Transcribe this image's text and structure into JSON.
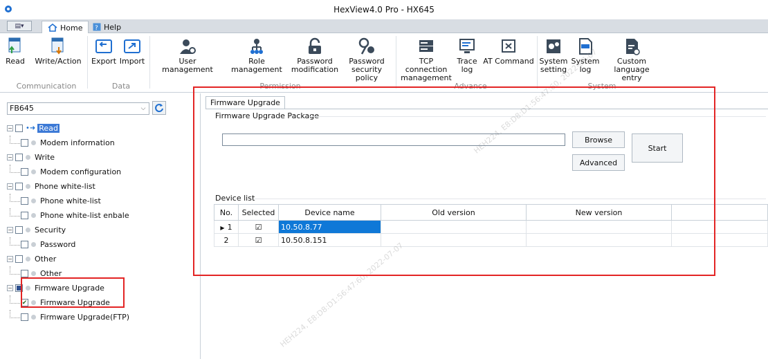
{
  "window": {
    "title": "HexView4.0 Pro - HX645"
  },
  "tabs": [
    {
      "label": "Home",
      "active": true
    },
    {
      "label": "Help",
      "active": false
    }
  ],
  "ribbon": {
    "communication": {
      "label": "Communication",
      "read": "Read",
      "write": "Write/Action"
    },
    "data": {
      "label": "Data",
      "export": "Export",
      "import": "Import"
    },
    "permission": {
      "label": "Permission",
      "user_mgmt": "User management",
      "role_mgmt": "Role management",
      "pwd_mod_1": "Password",
      "pwd_mod_2": "modification",
      "pwd_sec_1": "Password",
      "pwd_sec_2": "security policy"
    },
    "advance": {
      "label": "Advance",
      "tcp_1": "TCP connection",
      "tcp_2": "management",
      "trace_1": "Trace",
      "trace_2": "log",
      "at": "AT Command"
    },
    "system": {
      "label": "System",
      "setting_1": "System",
      "setting_2": "setting",
      "log_1": "System",
      "log_2": "log",
      "lang_1": "Custom",
      "lang_2": "language entry"
    }
  },
  "left": {
    "device_combo": "FB645",
    "tree": [
      {
        "label": "Read",
        "selected": true
      },
      {
        "label": "Modem information"
      },
      {
        "label": "Write"
      },
      {
        "label": "Modem configuration"
      },
      {
        "label": "Phone white-list"
      },
      {
        "label": "Phone white-list"
      },
      {
        "label": "Phone white-list enbale"
      },
      {
        "label": "Security"
      },
      {
        "label": "Password"
      },
      {
        "label": "Other"
      },
      {
        "label": "Other"
      },
      {
        "label": "Firmware Upgrade"
      },
      {
        "label": "Firmware Upgrade",
        "checked": true
      },
      {
        "label": "Firmware Upgrade(FTP)"
      }
    ]
  },
  "panel": {
    "tab": "Firmware Upgrade",
    "package_title": "Firmware Upgrade Package",
    "package_value": "",
    "browse": "Browse",
    "advanced": "Advanced",
    "start": "Start",
    "device_list_title": "Device list",
    "columns": [
      "No.",
      "Selected",
      "Device name",
      "Old version",
      "New version"
    ],
    "rows": [
      {
        "no": "1",
        "selected": "☑",
        "device": "10.50.8.77",
        "old": "",
        "new": ""
      },
      {
        "no": "2",
        "selected": "☑",
        "device": "10.50.8.151",
        "old": "",
        "new": ""
      }
    ]
  },
  "watermark": [
    "HEH224, E8:D8:D1:56:47:60, 2022-07-07"
  ],
  "colors": {
    "highlight_red": "#e32424",
    "selection_blue": "#0f78d7",
    "ribbon_bg": "#ffffff"
  }
}
